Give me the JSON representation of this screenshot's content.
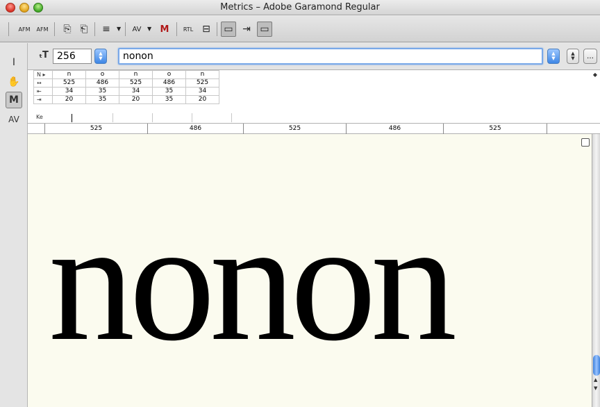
{
  "window": {
    "title": "Metrics – Adobe Garamond Regular"
  },
  "toolbar": {
    "buttons": [
      {
        "name": "open-afm",
        "label": "AFM"
      },
      {
        "name": "save-afm",
        "label": "AFM"
      },
      {
        "name": "copy-metrics",
        "label": "⎘"
      },
      {
        "name": "paste-metrics",
        "label": "⎗"
      },
      {
        "name": "metrics-options",
        "label": "≡"
      },
      {
        "name": "kerning-pairs",
        "label": "AV"
      },
      {
        "name": "auto-metrics",
        "label": "M"
      },
      {
        "name": "rtl",
        "label": "RTL"
      },
      {
        "name": "sidebearings",
        "label": "⊟"
      },
      {
        "name": "show-metrics-table",
        "label": "▭"
      },
      {
        "name": "show-ruler",
        "label": "⇥"
      },
      {
        "name": "show-panel",
        "label": "▭"
      }
    ]
  },
  "palette": {
    "tools": [
      {
        "name": "text-tool",
        "glyph": "I",
        "pressed": false
      },
      {
        "name": "hand-tool",
        "glyph": "✋",
        "pressed": false
      },
      {
        "name": "metrics-tool",
        "glyph": "M",
        "pressed": true
      },
      {
        "name": "kerning-tool",
        "glyph": "AV",
        "pressed": false
      }
    ]
  },
  "textrow": {
    "size": "256",
    "text": "nonon",
    "more_label": "…"
  },
  "metrics_table": {
    "row_labels": [
      "N ▸",
      "↔",
      "⇤",
      "⇥"
    ],
    "glyphs": [
      "n",
      "o",
      "n",
      "o",
      "n"
    ],
    "widths": [
      "525",
      "486",
      "525",
      "486",
      "525"
    ],
    "lsb": [
      "34",
      "35",
      "34",
      "35",
      "34"
    ],
    "rsb": [
      "20",
      "35",
      "20",
      "35",
      "20"
    ],
    "kern_label": "Ke"
  },
  "ruler": {
    "values": [
      "525",
      "486",
      "525",
      "486",
      "525"
    ]
  },
  "canvas": {
    "sample_text": "nonon"
  }
}
